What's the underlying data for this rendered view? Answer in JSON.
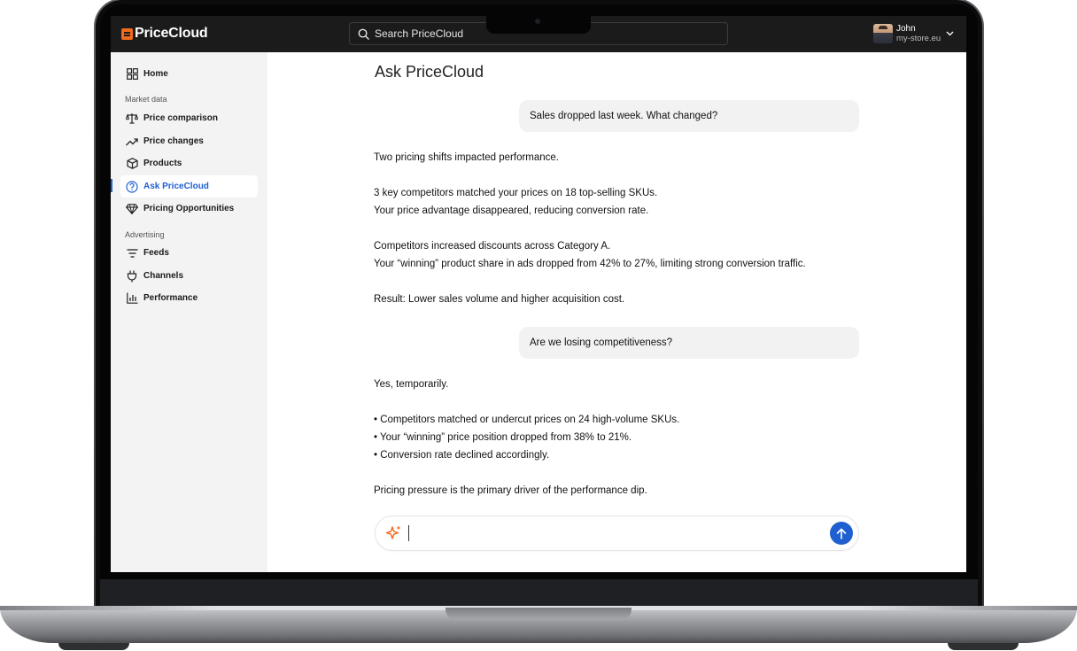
{
  "header": {
    "logo_text": "PriceCloud",
    "search_placeholder": "Search PriceCloud",
    "user_name": "John",
    "user_store": "my-store.eu"
  },
  "sidebar": {
    "home": "Home",
    "section_market": "Market data",
    "market_items": [
      {
        "label": "Price comparison",
        "icon": "scale-icon"
      },
      {
        "label": "Price changes",
        "icon": "trend-up-icon"
      },
      {
        "label": "Products",
        "icon": "box-icon"
      },
      {
        "label": "Ask PriceCloud",
        "icon": "question-circle-icon",
        "active": true
      },
      {
        "label": "Pricing Opportunities",
        "icon": "diamond-icon"
      }
    ],
    "section_advertising": "Advertising",
    "ad_items": [
      {
        "label": "Feeds",
        "icon": "filter-icon"
      },
      {
        "label": "Channels",
        "icon": "plug-icon"
      },
      {
        "label": "Performance",
        "icon": "bar-chart-icon"
      }
    ]
  },
  "chat": {
    "title": "Ask PriceCloud",
    "messages": [
      {
        "role": "user",
        "text": "Sales dropped last week. What changed?"
      },
      {
        "role": "assistant",
        "lines": [
          "Two pricing shifts impacted performance.",
          "",
          "3 key competitors matched your prices on 18 top-selling SKUs.",
          "Your price advantage disappeared, reducing conversion rate.",
          "",
          "Competitors increased discounts across Category A.",
          "Your “winning” product share in ads dropped from 42% to 27%, limiting strong conversion traffic.",
          "",
          "Result: Lower sales volume and higher acquisition cost."
        ]
      },
      {
        "role": "user",
        "text": "Are we losing competitiveness?"
      },
      {
        "role": "assistant",
        "lines": [
          "Yes, temporarily.",
          "",
          "• Competitors matched or undercut prices on 24 high-volume SKUs.",
          "• Your “winning” price position dropped from 38% to 21%.",
          "• Conversion rate declined accordingly.",
          "",
          "Pricing pressure is the primary driver of the performance dip."
        ]
      }
    ],
    "input_value": ""
  },
  "colors": {
    "accent": "#1e5fd1",
    "brand_orange": "#f26a1b",
    "topbar": "#1b1b1c",
    "sidebar_bg": "#f3f3f3"
  }
}
